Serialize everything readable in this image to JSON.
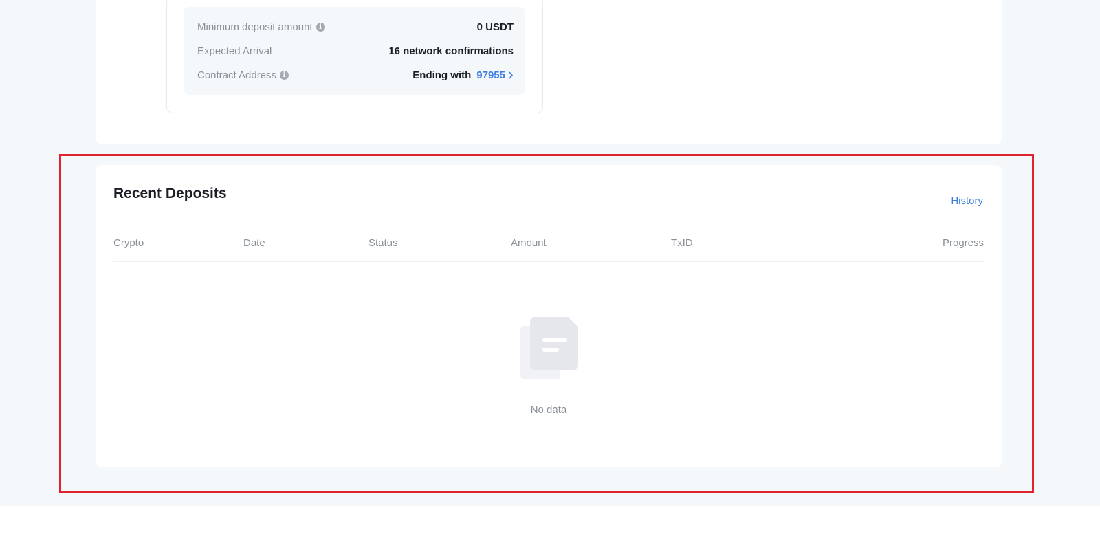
{
  "deposit_info": {
    "min_deposit": {
      "label": "Minimum deposit amount",
      "value": "0 USDT",
      "icon": "info-icon"
    },
    "expected_arrival": {
      "label": "Expected Arrival",
      "value": "16 network confirmations"
    },
    "contract_address": {
      "label": "Contract Address",
      "prefix": "Ending with",
      "value": "97955",
      "icon": "info-icon",
      "link_icon": "chevron-right-icon"
    }
  },
  "recent_deposits": {
    "title": "Recent Deposits",
    "history_link": "History",
    "columns": [
      "Crypto",
      "Date",
      "Status",
      "Amount",
      "TxID",
      "Progress"
    ],
    "empty_text": "No data",
    "empty_icon": "empty-document-icon"
  },
  "colors": {
    "accent": "#3b7de0",
    "highlight": "#e0242f",
    "page_bg": "#f5f8fb",
    "muted_text": "#8a8f99",
    "primary_text": "#1b1e24"
  }
}
